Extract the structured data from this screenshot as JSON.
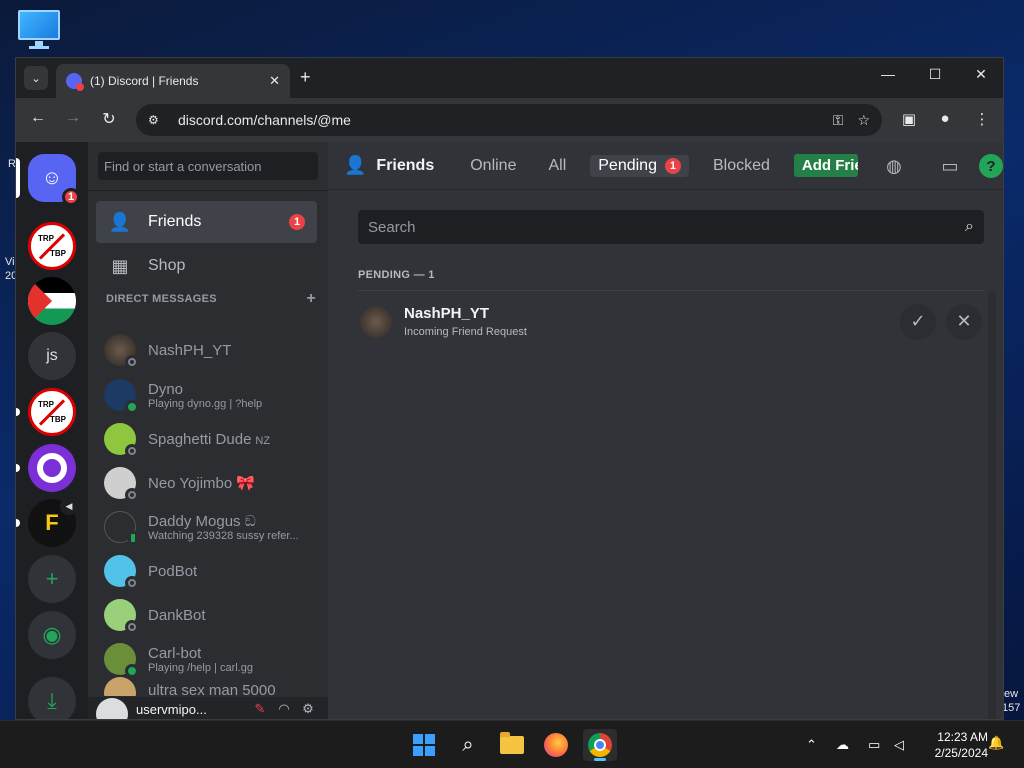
{
  "browser": {
    "tab_title": "(1) Discord | Friends",
    "url": "discord.com/channels/@me"
  },
  "guilds": {
    "home_badge": "1",
    "trp_top": "TRP",
    "trp_bottom": "TBP",
    "js_label": "js",
    "f_label": "F",
    "items": [
      "discord-home",
      "trp-tbp-server",
      "palestine-server",
      "js-server",
      "trp-tbp-server-2",
      "film-server",
      "f-server",
      "add-server",
      "explore-servers",
      "download-apps"
    ]
  },
  "dm_sidebar": {
    "search_placeholder": "Find or start a conversation",
    "nav": [
      {
        "label": "Friends",
        "badge": "1"
      },
      {
        "label": "Shop"
      }
    ],
    "dm_header": "DIRECT MESSAGES",
    "direct_messages": [
      {
        "name": "NashPH_YT",
        "status": "offline",
        "activity": ""
      },
      {
        "name": "Dyno",
        "status": "online",
        "activity": "Playing dyno.gg | ?help"
      },
      {
        "name": "Spaghetti Dude",
        "tag": "NZ",
        "status": "offline",
        "activity": ""
      },
      {
        "name": "Neo Yojimbo 🎀",
        "status": "offline",
        "activity": ""
      },
      {
        "name": "Daddy Mogus ඞ",
        "status": "mobile",
        "activity": "Watching 239328 sussy refer..."
      },
      {
        "name": "PodBot",
        "status": "offline",
        "activity": ""
      },
      {
        "name": "DankBot",
        "status": "offline",
        "activity": ""
      },
      {
        "name": "Carl-bot",
        "status": "online",
        "activity": "Playing /help | carl.gg"
      },
      {
        "name": "ultra sex man 5000",
        "status": "offline",
        "activity": ""
      }
    ],
    "user": {
      "name": "uservmipo..."
    }
  },
  "friends": {
    "title": "Friends",
    "tabs": [
      {
        "label": "Online"
      },
      {
        "label": "All"
      },
      {
        "label": "Pending",
        "badge": "1"
      },
      {
        "label": "Blocked"
      }
    ],
    "add_friend": "Add Friend",
    "search_placeholder": "Search",
    "pending_label": "PENDING — 1",
    "pending": [
      {
        "name": "NashPH_YT",
        "subtitle": "Incoming Friend Request"
      }
    ]
  },
  "taskbar": {
    "time": "12:23 AM",
    "date": "2/25/2024"
  },
  "desktop": {
    "frag_left_1": "R",
    "frag_left_2": "Vi",
    "frag_left_3": "20",
    "frag_right_1": "ew",
    "frag_right_2": "157"
  },
  "colors": {
    "blurple": "#5865f2",
    "online": "#23a559",
    "badge_red": "#ed4245",
    "add_friend_green": "#248046"
  }
}
